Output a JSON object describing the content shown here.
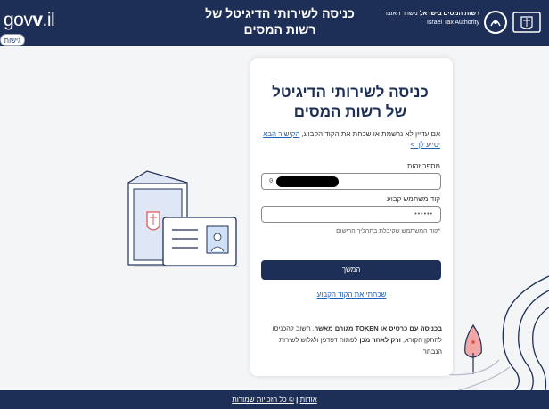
{
  "header": {
    "gov_logo": {
      "prefix": "gov",
      "v": "v",
      "suffix": ".il"
    },
    "title": "כניסה לשירותי הדיגיטל של רשות המסים",
    "authority_he": "רשות המסים בישראל",
    "ministry_he": "משרד האוצר",
    "authority_en": "Israel Tax Authority",
    "lang_button": "גישות"
  },
  "card": {
    "title": "כניסה לשירותי הדיגיטל של רשות המסים",
    "info_text": "אם עדיין לא נרשמת או שכחת את הקוד הקבוע,",
    "info_link": "הקישור הבא יסייע לך >",
    "id_label": "מספר זהות",
    "id_value": "0",
    "code_label": "קוד משתמש קבוע",
    "code_value": "••••••",
    "code_hint": "*קוד המשתמש שקיבלת בתהליך הרישום",
    "submit_label": "המשך",
    "forgot_link": "שכחתי את הקוד הקבוע",
    "token_note": {
      "part1": "בכניסה עם כרטיס או",
      "token": "TOKEN",
      "part2": "מגורם מאשר",
      "part3": ", חשוב להכניסו להתקן הקורא,",
      "part4": "ורק לאחר מכן",
      "part5": "לפתוח דפדפן ולגלוש לשירות הנבחר"
    }
  },
  "footer": {
    "about": "אודות",
    "separator": "|",
    "rights": "© כל הזכויות שמורות"
  },
  "colors": {
    "navy": "#1e2f57",
    "link": "#1f5fbf",
    "background": "#f4f5f7"
  }
}
